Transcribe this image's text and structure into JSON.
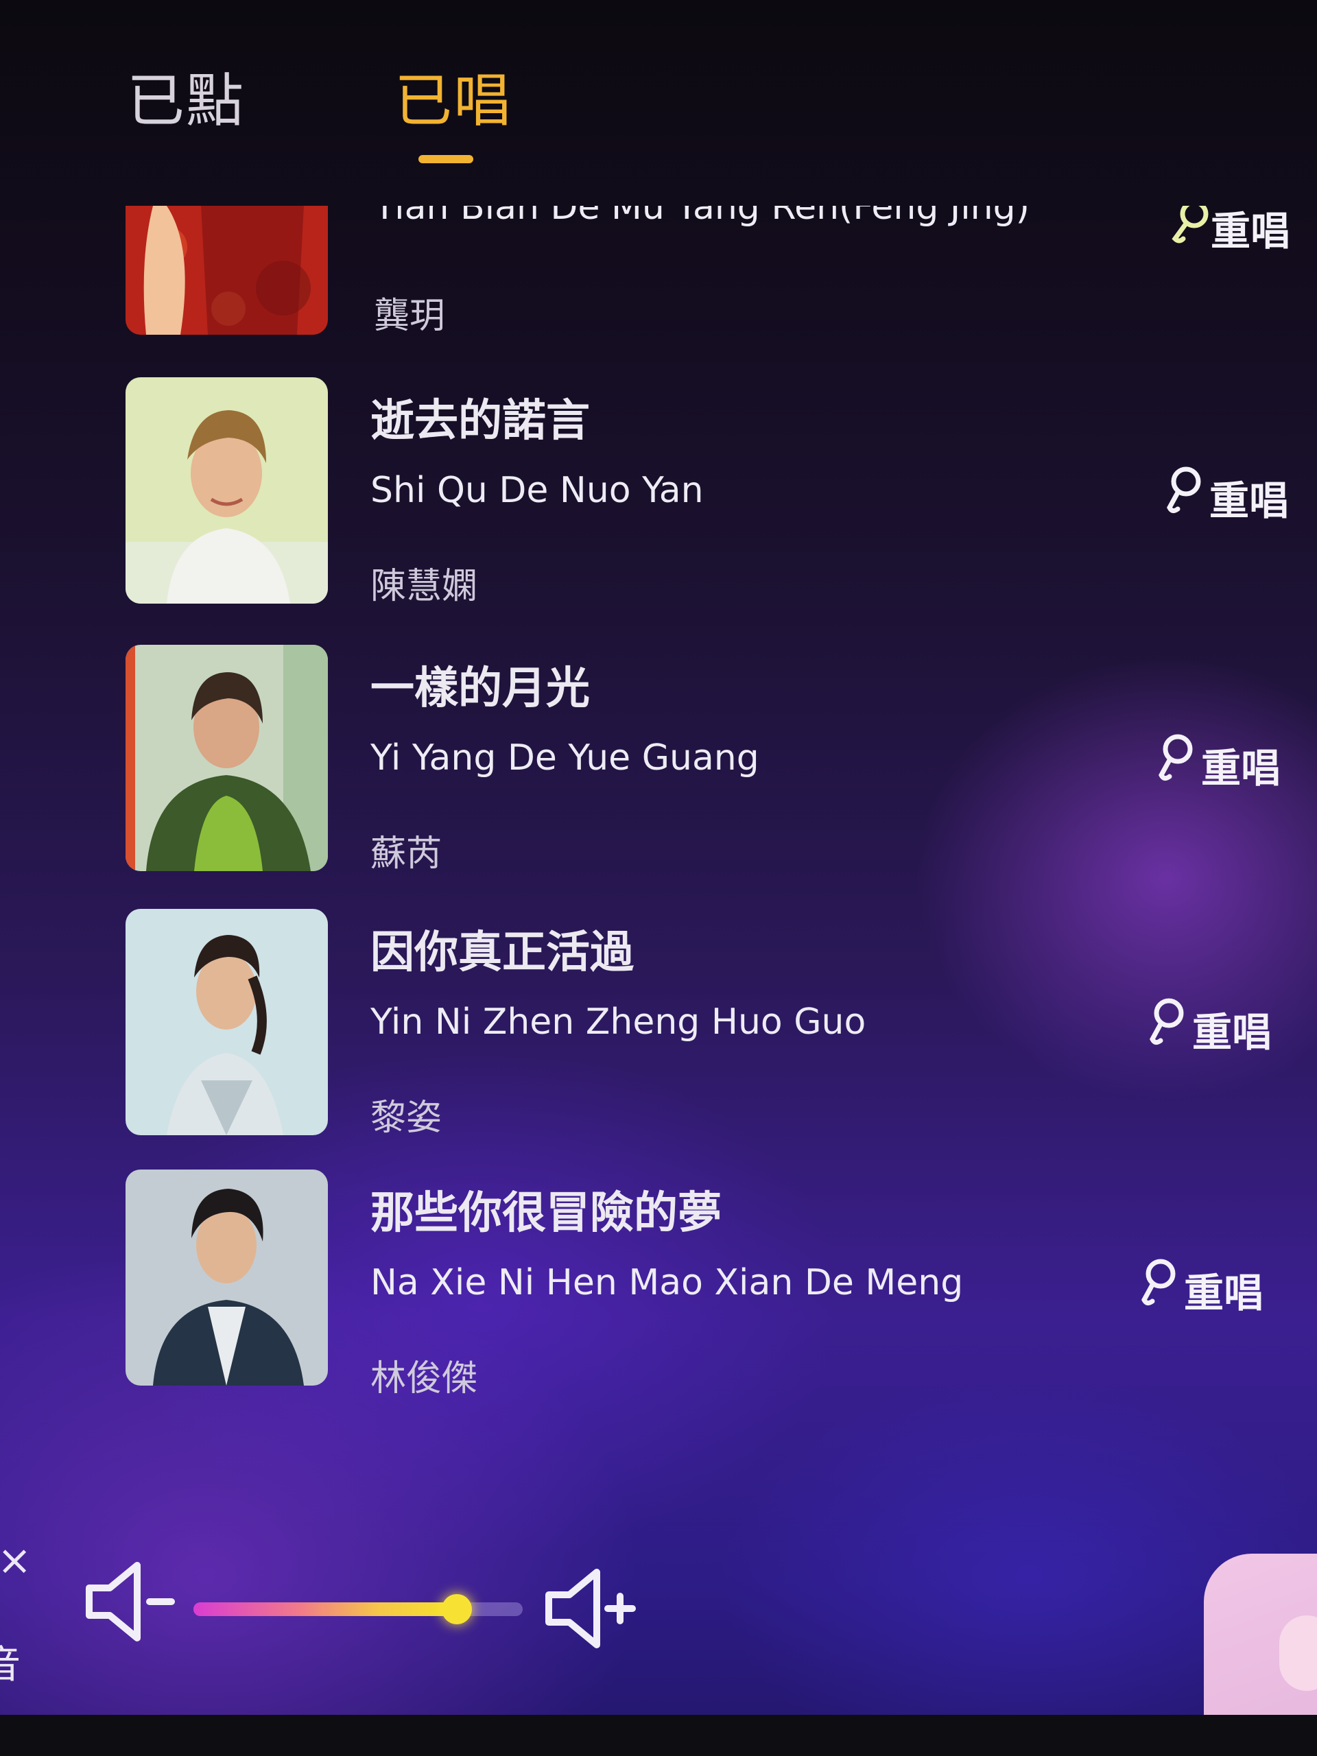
{
  "tabs": {
    "queued": "已點",
    "sung": "已唱"
  },
  "partial_song": {
    "pinyin": "Tian Bian De Mu Yang Ren(Feng Jing)",
    "artist": "龔玥",
    "action": "重唱"
  },
  "songs": [
    {
      "title": "逝去的諾言",
      "pinyin": "Shi Qu De Nuo Yan",
      "artist": "陳慧嫻",
      "action": "重唱"
    },
    {
      "title": "一樣的月光",
      "pinyin": "Yi Yang De Yue Guang",
      "artist": "蘇芮",
      "action": "重唱"
    },
    {
      "title": "因你真正活過",
      "pinyin": "Yin Ni Zhen Zheng Huo Guo",
      "artist": "黎姿",
      "action": "重唱"
    },
    {
      "title": "那些你很冒險的夢",
      "pinyin": "Na Xie Ni Hen Mao Xian De Meng",
      "artist": "林俊傑",
      "action": "重唱"
    }
  ],
  "volume": {
    "level": 0.8
  },
  "left_edge": {
    "close": "×",
    "label": "音"
  },
  "colors": {
    "accent": "#f2b332",
    "text": "#eeecf4",
    "background_top": "#0c0a10",
    "background_bottom": "#2d1c86"
  },
  "icons": {
    "resing": "mic-icon",
    "volume_down": "volume-down-icon",
    "volume_up": "volume-up-icon"
  }
}
